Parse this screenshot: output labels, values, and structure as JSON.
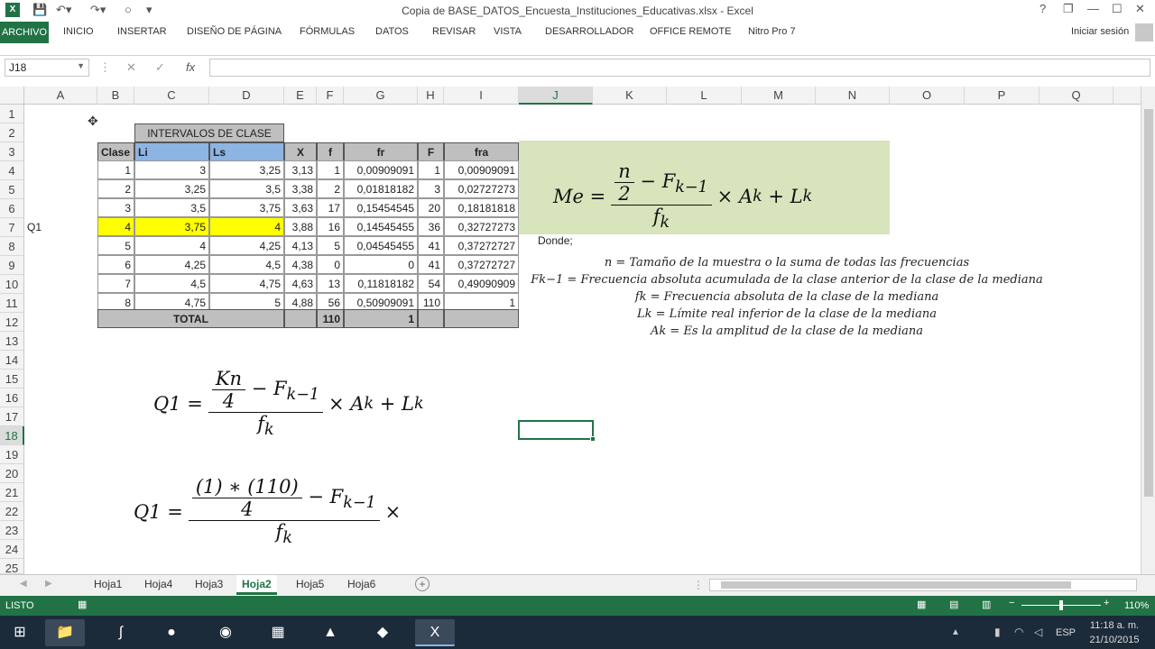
{
  "window": {
    "title": "Copia de BASE_DATOS_Encuesta_Instituciones_Educativas.xlsx - Excel",
    "help": "?",
    "restore": "❐",
    "minimize": "—",
    "maximize": "☐",
    "close": "✕"
  },
  "ribbon": {
    "file_tab": "ARCHIVO",
    "tabs": [
      "INICIO",
      "INSERTAR",
      "DISEÑO DE PÁGINA",
      "FÓRMULAS",
      "DATOS",
      "REVISAR",
      "VISTA",
      "DESARROLLADOR",
      "OFFICE REMOTE",
      "Nitro Pro 7"
    ],
    "signin": "Iniciar sesión"
  },
  "formula_bar": {
    "name_box": "J18",
    "fx": "fx",
    "value": ""
  },
  "columns": [
    "A",
    "B",
    "C",
    "D",
    "E",
    "F",
    "G",
    "H",
    "I",
    "J",
    "K",
    "L",
    "M",
    "N",
    "O",
    "P",
    "Q"
  ],
  "rows": [
    "1",
    "2",
    "3",
    "4",
    "5",
    "6",
    "7",
    "8",
    "9",
    "10",
    "11",
    "12",
    "13",
    "14",
    "15",
    "16",
    "17",
    "18",
    "19",
    "20",
    "21",
    "22",
    "23",
    "24",
    "25"
  ],
  "sheet": {
    "group_header": "INTERVALOS DE CLASE",
    "headers": [
      "Clase",
      "Li",
      "Ls",
      "X",
      "f",
      "fr",
      "F",
      "fra"
    ],
    "rows": [
      [
        "1",
        "3",
        "3,25",
        "3,13",
        "1",
        "0,00909091",
        "1",
        "0,00909091"
      ],
      [
        "2",
        "3,25",
        "3,5",
        "3,38",
        "2",
        "0,01818182",
        "3",
        "0,02727273"
      ],
      [
        "3",
        "3,5",
        "3,75",
        "3,63",
        "17",
        "0,15454545",
        "20",
        "0,18181818"
      ],
      [
        "4",
        "3,75",
        "4",
        "3,88",
        "16",
        "0,14545455",
        "36",
        "0,32727273"
      ],
      [
        "5",
        "4",
        "4,25",
        "4,13",
        "5",
        "0,04545455",
        "41",
        "0,37272727"
      ],
      [
        "6",
        "4,25",
        "4,5",
        "4,38",
        "0",
        "0",
        "41",
        "0,37272727"
      ],
      [
        "7",
        "4,5",
        "4,75",
        "4,63",
        "13",
        "0,11818182",
        "54",
        "0,49090909"
      ],
      [
        "8",
        "4,75",
        "5",
        "4,88",
        "56",
        "0,50909091",
        "110",
        "1"
      ]
    ],
    "total_label": "TOTAL",
    "total_f": "110",
    "total_fr": "1",
    "q1_label": "Q1"
  },
  "formulas": {
    "me_lhs": "Me =",
    "n": "n",
    "two": "2",
    "minus_fk1": "− F",
    "sub_k1": "k−1",
    "fk": "f",
    "sub_k": "k",
    "times_ak_lk": "× A",
    "plus_l": "+ L",
    "q1_lhs": "Q1 =",
    "kn": "Kn",
    "four": "4",
    "q1b_num": "(1) ∗ (110)",
    "times_cut": "× ."
  },
  "definitions": {
    "donde": "Donde;",
    "lines": [
      "n = Tamaño de la muestra o la suma de todas las frecuencias",
      "Fk−1 = Frecuencia absoluta acumulada de la clase anterior de la clase de la mediana",
      "fk = Frecuencia absoluta de la clase de la mediana",
      "Lk = Límite real inferior de la clase de la mediana",
      "Ak = Es la amplitud de la clase de la mediana"
    ]
  },
  "sheet_tabs": [
    "Hoja1",
    "Hoja4",
    "Hoja3",
    "Hoja2",
    "Hoja5",
    "Hoja6"
  ],
  "active_sheet": "Hoja2",
  "status": {
    "ready": "LISTO",
    "zoom": "110%"
  },
  "taskbar": {
    "lang": "ESP",
    "time": "11:18 a. m.",
    "date": "21/10/2015"
  },
  "colors": {
    "excel_green": "#217346",
    "header_gray": "#bfbfbf",
    "li_ls_blue": "#8db4e2",
    "highlight_yellow": "#ffff00",
    "formula_box": "#d8e4bc"
  }
}
